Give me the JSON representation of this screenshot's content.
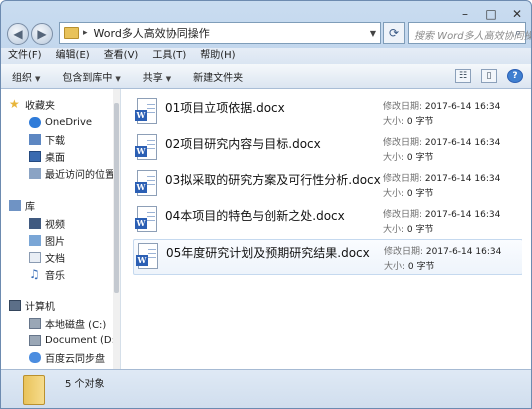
{
  "window": {
    "address_path": "Word多人高效协同操作",
    "search_placeholder": "搜索 Word多人高效协同操...",
    "controls": {
      "minimize": "–",
      "maximize": "□",
      "close": "✕"
    }
  },
  "menubar": [
    "文件(F)",
    "编辑(E)",
    "查看(V)",
    "工具(T)",
    "帮助(H)"
  ],
  "toolbar": {
    "organize": "组织",
    "include_library": "包含到库中",
    "share": "共享",
    "new_folder": "新建文件夹"
  },
  "sidebar": {
    "favorites": {
      "header": "收藏夹",
      "items": [
        "OneDrive",
        "下载",
        "桌面",
        "最近访问的位置"
      ]
    },
    "libraries": {
      "header": "库",
      "items": [
        "视频",
        "图片",
        "文档",
        "音乐"
      ]
    },
    "computer": {
      "header": "计算机",
      "items": [
        "本地磁盘 (C:)",
        "Document (D:)",
        "百度云同步盘"
      ]
    }
  },
  "files": [
    {
      "name": "01项目立项依据.docx",
      "modified_label": "修改日期:",
      "modified": "2017-6-14 16:34",
      "size_label": "大小:",
      "size": "0 字节"
    },
    {
      "name": "02项目研究内容与目标.docx",
      "modified_label": "修改日期:",
      "modified": "2017-6-14 16:34",
      "size_label": "大小:",
      "size": "0 字节"
    },
    {
      "name": "03拟采取的研究方案及可行性分析.docx",
      "modified_label": "修改日期:",
      "modified": "2017-6-14 16:34",
      "size_label": "大小:",
      "size": "0 字节"
    },
    {
      "name": "04本项目的特色与创新之处.docx",
      "modified_label": "修改日期:",
      "modified": "2017-6-14 16:34",
      "size_label": "大小:",
      "size": "0 字节"
    },
    {
      "name": "05年度研究计划及预期研究结果.docx",
      "modified_label": "修改日期:",
      "modified": "2017-6-14 16:34",
      "size_label": "大小:",
      "size": "0 字节"
    }
  ],
  "status": {
    "count": "5 个对象"
  },
  "colors": {
    "folder": "#e8c25a",
    "word_icon": "#2b5fb4",
    "selection": "#c5d9ef"
  }
}
